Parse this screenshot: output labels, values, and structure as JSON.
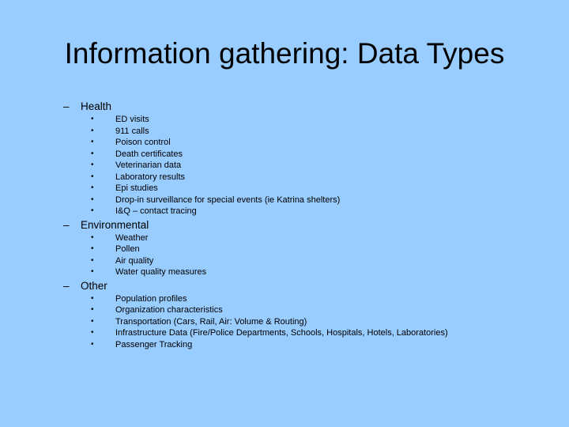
{
  "slide": {
    "title": "Information gathering: Data Types",
    "background_color": "#99ccff",
    "sections": [
      {
        "marker": "–",
        "label": "Health",
        "items": [
          "ED visits",
          "911 calls",
          "Poison control",
          "Death certificates",
          "Veterinarian data",
          "Laboratory results",
          "Epi studies",
          "Drop-in surveillance for special events (ie Katrina shelters)",
          "I&Q – contact tracing"
        ]
      },
      {
        "marker": "–",
        "label": "Environmental",
        "items": [
          "Weather",
          "Pollen",
          "Air quality",
          "Water quality measures"
        ]
      },
      {
        "marker": "–",
        "label": "Other",
        "items": [
          "Population profiles",
          "Organization characteristics",
          "Transportation (Cars, Rail, Air: Volume & Routing)",
          "Infrastructure Data (Fire/Police Departments, Schools, Hospitals, Hotels, Laboratories)",
          "Passenger Tracking"
        ]
      }
    ],
    "bullet_glyph": "•"
  }
}
